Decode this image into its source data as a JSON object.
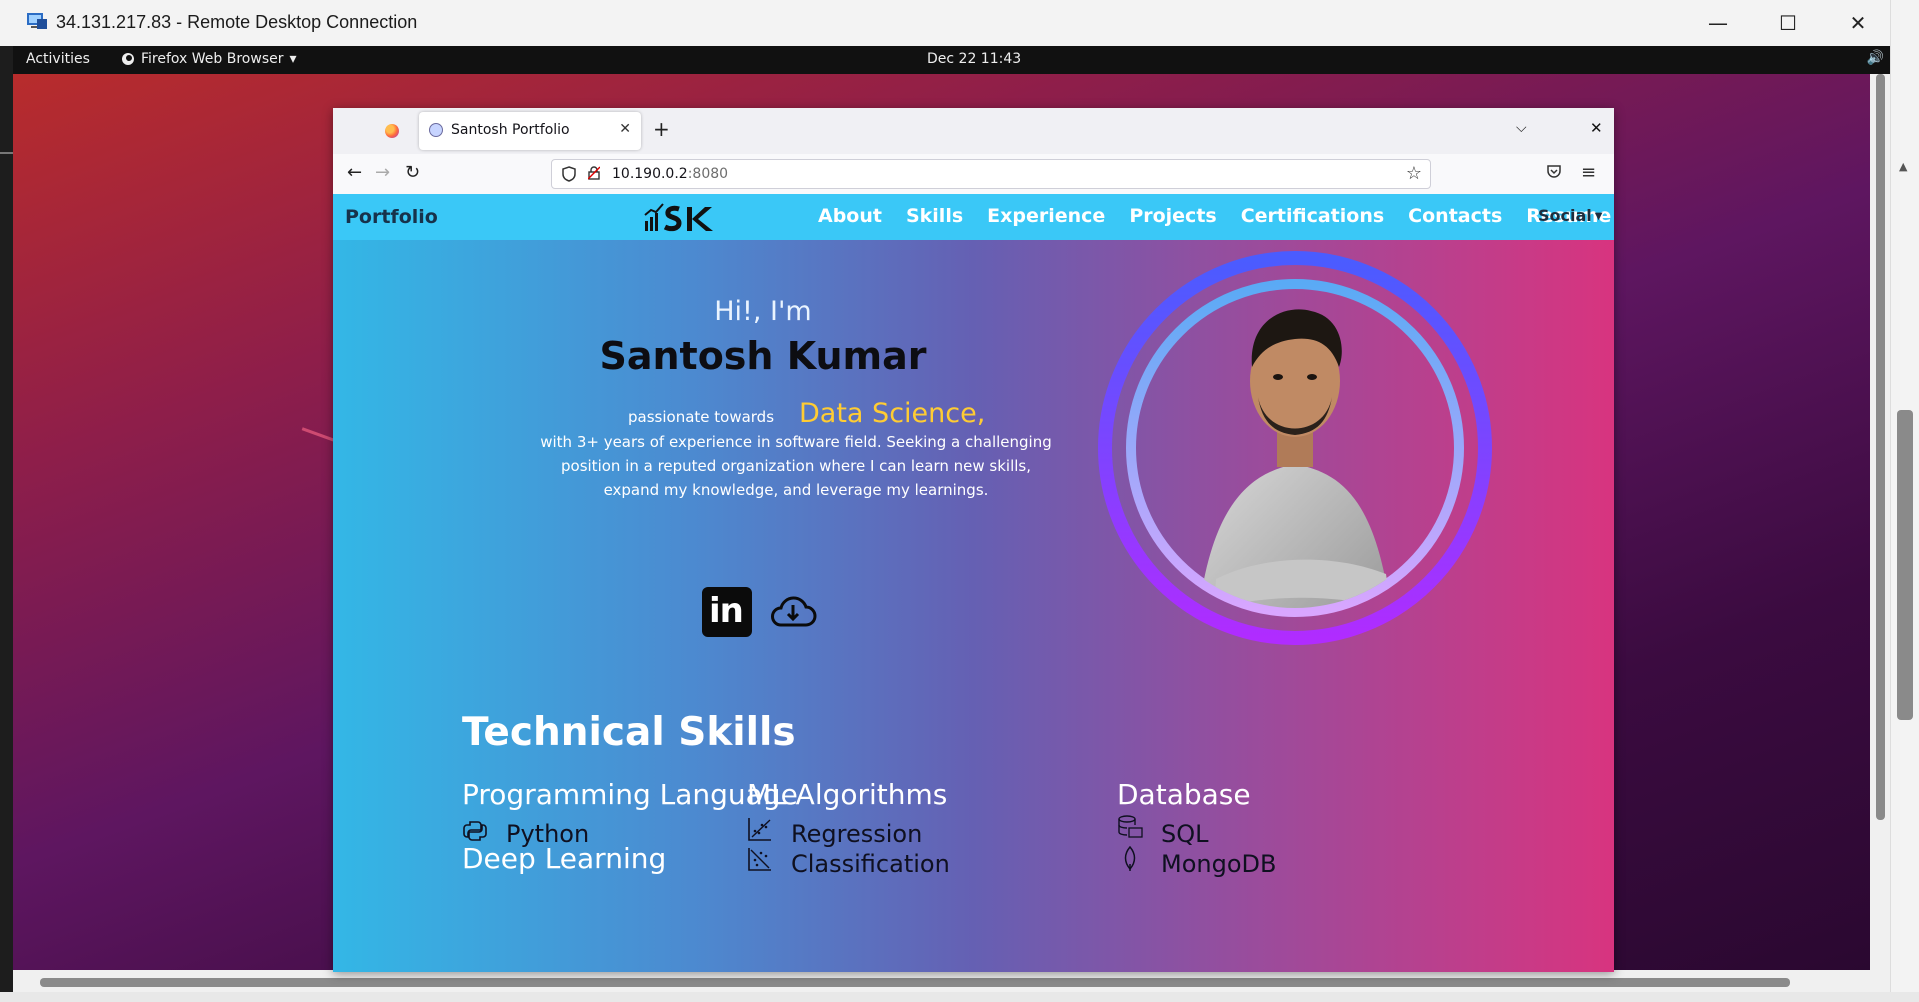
{
  "rdp": {
    "title": "34.131.217.83 - Remote Desktop Connection",
    "minimize": "—",
    "maximize": "☐",
    "close": "✕"
  },
  "gnome": {
    "activities": "Activities",
    "app_name": "Firefox Web Browser",
    "app_caret": "▾",
    "clock": "Dec 22  11:43",
    "sound": "🔊"
  },
  "firefox": {
    "tab_title": "Santosh Portfolio",
    "tab_close": "✕",
    "new_tab": "+",
    "list_tabs": "⌵",
    "window_close": "✕",
    "back": "←",
    "forward": "→",
    "reload": "↻",
    "url_host": "10.190.0.2",
    "url_port": ":8080",
    "bookmark": "☆",
    "menu": "≡"
  },
  "site": {
    "brand": "Portfolio",
    "nav": [
      "About",
      "Skills",
      "Experience",
      "Projects",
      "Certifications",
      "Contacts",
      "Resume"
    ],
    "social": "Social",
    "hero": {
      "greeting": "Hi!, I'm",
      "name": "Santosh Kumar",
      "passion": "passionate towards",
      "focus": "Data Science,",
      "description": "with 3+ years of experience in software field. Seeking a challenging position in a reputed organization where I can learn new skills, expand my knowledge, and leverage my learnings.",
      "linkedin_glyph": "in"
    },
    "skills": {
      "title": "Technical Skills",
      "programming": {
        "title": "Programming Language",
        "items": [
          "Python"
        ]
      },
      "deep_learning": {
        "title": "Deep Learning"
      },
      "ml": {
        "title": "ML Algorithms",
        "items": [
          "Regression",
          "Classification"
        ]
      },
      "database": {
        "title": "Database",
        "items": [
          "SQL",
          "MongoDB"
        ]
      }
    }
  },
  "colors": {
    "nav_bg": "#3ac8f7",
    "accent": "#ffcc33",
    "gradient_left": "#33b7e6",
    "gradient_right": "#d8347f"
  }
}
